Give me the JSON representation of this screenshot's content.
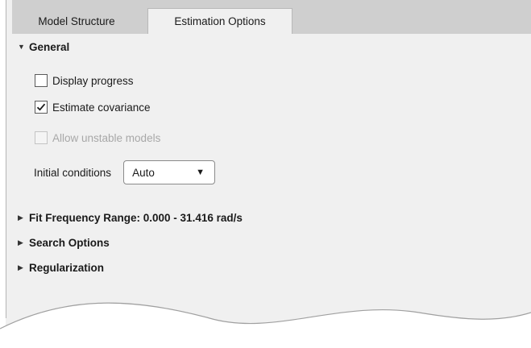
{
  "tabs": [
    {
      "label": "Model Structure",
      "active": false
    },
    {
      "label": "Estimation Options",
      "active": true
    }
  ],
  "general": {
    "title": "General",
    "expanded": true,
    "checkboxes": [
      {
        "label": "Display progress",
        "checked": false,
        "enabled": true
      },
      {
        "label": "Estimate covariance",
        "checked": true,
        "enabled": true
      },
      {
        "label": "Allow unstable models",
        "checked": false,
        "enabled": false
      }
    ],
    "initial_conditions": {
      "label": "Initial conditions",
      "value": "Auto"
    }
  },
  "sections": [
    {
      "title": "Fit Frequency Range: 0.000 - 31.416 rad/s",
      "expanded": false
    },
    {
      "title": "Search Options",
      "expanded": false
    },
    {
      "title": "Regularization",
      "expanded": false
    }
  ],
  "icons": {
    "expanded": "caret-down-icon",
    "collapsed": "caret-right-icon",
    "dropdown": "dropdown-arrow-icon",
    "check": "checkmark-icon"
  }
}
